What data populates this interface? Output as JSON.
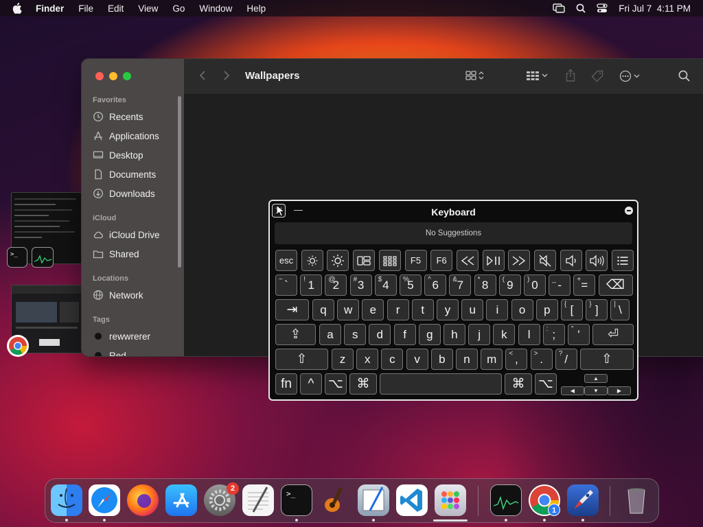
{
  "menubar": {
    "app": "Finder",
    "items": [
      "File",
      "Edit",
      "View",
      "Go",
      "Window",
      "Help"
    ],
    "clock": "Fri Jul 7  4:11 PM"
  },
  "finder": {
    "title": "Wallpapers",
    "sidebar": {
      "favorites_heading": "Favorites",
      "favorites": [
        "Recents",
        "Applications",
        "Desktop",
        "Documents",
        "Downloads"
      ],
      "icloud_heading": "iCloud",
      "icloud": [
        "iCloud Drive",
        "Shared"
      ],
      "locations_heading": "Locations",
      "locations": [
        "Network"
      ],
      "tags_heading": "Tags",
      "tags": [
        "rewwrerer",
        "Red"
      ]
    }
  },
  "keyboard": {
    "title": "Keyboard",
    "suggestions": "No Suggestions",
    "fn_row": [
      "esc",
      "brightness-down-icon",
      "brightness-up-icon",
      "mission-control-icon",
      "launchpad-icon",
      "F5",
      "F6",
      "rewind-icon",
      "play-pause-icon",
      "fast-forward-icon",
      "mute-icon",
      "volume-down-icon",
      "volume-up-icon",
      "list-icon"
    ],
    "number_row": [
      {
        "main": "`",
        "shift": "~"
      },
      {
        "main": "1",
        "shift": "!"
      },
      {
        "main": "2",
        "shift": "@"
      },
      {
        "main": "3",
        "shift": "#"
      },
      {
        "main": "4",
        "shift": "$"
      },
      {
        "main": "5",
        "shift": "%"
      },
      {
        "main": "6",
        "shift": "^"
      },
      {
        "main": "7",
        "shift": "&"
      },
      {
        "main": "8",
        "shift": "*"
      },
      {
        "main": "9",
        "shift": "("
      },
      {
        "main": "0",
        "shift": ")"
      },
      {
        "main": "-",
        "shift": "_"
      },
      {
        "main": "=",
        "shift": "+"
      },
      {
        "main": "⌫",
        "shift": ""
      }
    ],
    "row_q": [
      "⇥",
      "q",
      "w",
      "e",
      "r",
      "t",
      "y",
      "u",
      "i",
      "o",
      "p",
      "[",
      "]",
      "\\"
    ],
    "row_q_shift": [
      "",
      "",
      "",
      "",
      "",
      "",
      "",
      "",
      "",
      "",
      "",
      "{",
      "}",
      "|"
    ],
    "row_a": [
      "⇪",
      "a",
      "s",
      "d",
      "f",
      "g",
      "h",
      "j",
      "k",
      "l",
      ";",
      "'",
      "⏎"
    ],
    "row_a_shift": [
      "",
      "",
      "",
      "",
      "",
      "",
      "",
      "",
      "",
      "",
      ":",
      "\"",
      ""
    ],
    "row_z": [
      "⇧",
      "z",
      "x",
      "c",
      "v",
      "b",
      "n",
      "m",
      ",",
      ".",
      "/",
      "⇧"
    ],
    "row_z_shift": [
      "",
      "",
      "",
      "",
      "",
      "",
      "",
      "",
      "<",
      ">",
      "?",
      ""
    ],
    "row_bottom": [
      "fn",
      "^",
      "⌥",
      "⌘",
      "",
      "⌘",
      "⌥"
    ],
    "arrows": [
      "▲",
      "◀",
      "▼",
      "▶"
    ]
  },
  "dock": {
    "apps": [
      "Finder",
      "Safari",
      "Firefox",
      "App Store",
      "System Settings",
      "TextEdit",
      "Terminal",
      "GarageBand",
      "Preview",
      "Visual Studio Code",
      "Launchpad",
      "Activity Monitor",
      "Google Chrome",
      "RocketSim",
      "Trash"
    ],
    "settings_badge": "2",
    "chrome_badge": "1"
  },
  "colors": {
    "close": "#ff5f57",
    "minimize": "#febc2e",
    "zoom": "#28c840"
  }
}
